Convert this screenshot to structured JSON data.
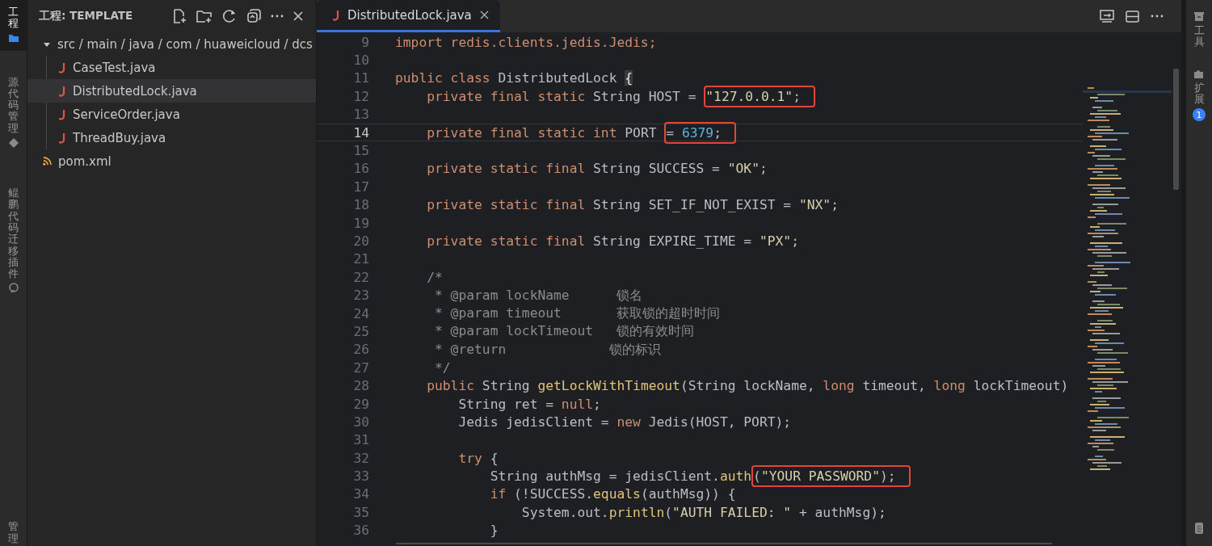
{
  "activity_bar": {
    "items": [
      {
        "label": "工程",
        "selected": true
      },
      {
        "label": "源代码管理",
        "selected": false
      },
      {
        "label": "鲲鹏代码迁移插件",
        "selected": false
      }
    ],
    "bottom_label": "管理"
  },
  "sidebar": {
    "title": "工程: TEMPLATE",
    "tree": [
      {
        "label": "src / main / java / com / huaweicloud / dcs",
        "kind": "folder",
        "expanded": true,
        "selected": false,
        "children": [
          {
            "label": "CaseTest.java",
            "kind": "java",
            "selected": false
          },
          {
            "label": "DistributedLock.java",
            "kind": "java",
            "selected": true
          },
          {
            "label": "ServiceOrder.java",
            "kind": "java",
            "selected": false
          },
          {
            "label": "ThreadBuy.java",
            "kind": "java",
            "selected": false
          }
        ]
      },
      {
        "label": "pom.xml",
        "kind": "xml",
        "selected": false
      }
    ]
  },
  "editor": {
    "tabs": [
      {
        "label": "DistributedLock.java",
        "kind": "java",
        "selected": true
      }
    ],
    "lines": [
      {
        "number": "9",
        "current": false,
        "tokens": [
          {
            "kind": "keyword",
            "text": "import redis.clients.jedis.Jedis;"
          }
        ]
      },
      {
        "number": "10",
        "current": false
      },
      {
        "number": "11",
        "current": false,
        "tokens": [
          {
            "kind": "keyword",
            "text": "public class"
          },
          {
            "kind": "plain",
            "text": " DistributedLock "
          },
          {
            "kind": "brace",
            "text": "{"
          }
        ]
      },
      {
        "number": "12",
        "current": false,
        "tokens": [
          {
            "kind": "keyword",
            "text": "    private final static"
          },
          {
            "kind": "plain",
            "text": " String HOST = "
          },
          {
            "kind": "string",
            "text": "\"127.0.0.1\"",
            "boxed": true
          },
          {
            "kind": "plain",
            "text": ";",
            "boxed": true
          }
        ]
      },
      {
        "number": "13",
        "current": false
      },
      {
        "number": "14",
        "current": true,
        "tokens": [
          {
            "kind": "keyword",
            "text": "    private final static int"
          },
          {
            "kind": "plain",
            "text": " PORT "
          },
          {
            "kind": "plain",
            "text": "= ",
            "boxed": true
          },
          {
            "kind": "number",
            "text": "6379",
            "boxed": true
          },
          {
            "kind": "plain",
            "text": ";",
            "boxed": true
          }
        ]
      },
      {
        "number": "15",
        "current": false
      },
      {
        "number": "16",
        "current": false,
        "tokens": [
          {
            "kind": "keyword",
            "text": "    private static final"
          },
          {
            "kind": "plain",
            "text": " String SUCCESS = "
          },
          {
            "kind": "string",
            "text": "\"OK\""
          },
          {
            "kind": "plain",
            "text": ";"
          }
        ]
      },
      {
        "number": "17",
        "current": false
      },
      {
        "number": "18",
        "current": false,
        "tokens": [
          {
            "kind": "keyword",
            "text": "    private static final"
          },
          {
            "kind": "plain",
            "text": " String SET_IF_NOT_EXIST = "
          },
          {
            "kind": "string",
            "text": "\"NX\""
          },
          {
            "kind": "plain",
            "text": ";"
          }
        ]
      },
      {
        "number": "19",
        "current": false
      },
      {
        "number": "20",
        "current": false,
        "tokens": [
          {
            "kind": "keyword",
            "text": "    private static final"
          },
          {
            "kind": "plain",
            "text": " String EXPIRE_TIME = "
          },
          {
            "kind": "string",
            "text": "\"PX\""
          },
          {
            "kind": "plain",
            "text": ";"
          }
        ]
      },
      {
        "number": "21",
        "current": false
      },
      {
        "number": "22",
        "current": false,
        "tokens": [
          {
            "kind": "comment",
            "text": "    /*"
          }
        ]
      },
      {
        "number": "23",
        "current": false,
        "tokens": [
          {
            "kind": "comment",
            "text": "     * @param lockName      锁名"
          }
        ]
      },
      {
        "number": "24",
        "current": false,
        "tokens": [
          {
            "kind": "comment",
            "text": "     * @param timeout       获取锁的超时时间"
          }
        ]
      },
      {
        "number": "25",
        "current": false,
        "tokens": [
          {
            "kind": "comment",
            "text": "     * @param lockTimeout   锁的有效时间"
          }
        ]
      },
      {
        "number": "26",
        "current": false,
        "tokens": [
          {
            "kind": "comment",
            "text": "     * @return             锁的标识"
          }
        ]
      },
      {
        "number": "27",
        "current": false,
        "tokens": [
          {
            "kind": "comment",
            "text": "     */"
          }
        ]
      },
      {
        "number": "28",
        "current": false,
        "tokens": [
          {
            "kind": "keyword",
            "text": "    public"
          },
          {
            "kind": "plain",
            "text": " String "
          },
          {
            "kind": "function",
            "text": "getLockWithTimeout"
          },
          {
            "kind": "plain",
            "text": "(String lockName, "
          },
          {
            "kind": "keyword",
            "text": "long"
          },
          {
            "kind": "plain",
            "text": " timeout, "
          },
          {
            "kind": "keyword",
            "text": "long"
          },
          {
            "kind": "plain",
            "text": " lockTimeout)"
          }
        ]
      },
      {
        "number": "29",
        "current": false,
        "tokens": [
          {
            "kind": "plain",
            "text": "        String ret = "
          },
          {
            "kind": "keyword",
            "text": "null"
          },
          {
            "kind": "plain",
            "text": ";"
          }
        ]
      },
      {
        "number": "30",
        "current": false,
        "tokens": [
          {
            "kind": "plain",
            "text": "        Jedis jedisClient = "
          },
          {
            "kind": "keyword",
            "text": "new"
          },
          {
            "kind": "plain",
            "text": " Jedis(HOST, PORT);"
          }
        ]
      },
      {
        "number": "31",
        "current": false
      },
      {
        "number": "32",
        "current": false,
        "tokens": [
          {
            "kind": "keyword",
            "text": "        try"
          },
          {
            "kind": "plain",
            "text": " {"
          }
        ]
      },
      {
        "number": "33",
        "current": false,
        "tokens": [
          {
            "kind": "plain",
            "text": "            String authMsg = jedisClient."
          },
          {
            "kind": "function",
            "text": "auth"
          },
          {
            "kind": "plain",
            "text": "(",
            "boxed": true
          },
          {
            "kind": "string",
            "text": "\"YOUR PASSWORD\"",
            "boxed": true
          },
          {
            "kind": "plain",
            "text": ");",
            "boxed": true
          }
        ]
      },
      {
        "number": "34",
        "current": false,
        "tokens": [
          {
            "kind": "keyword",
            "text": "            if"
          },
          {
            "kind": "plain",
            "text": " (!SUCCESS."
          },
          {
            "kind": "function",
            "text": "equals"
          },
          {
            "kind": "plain",
            "text": "(authMsg)) {"
          }
        ]
      },
      {
        "number": "35",
        "current": false,
        "tokens": [
          {
            "kind": "plain",
            "text": "                System.out."
          },
          {
            "kind": "function",
            "text": "println"
          },
          {
            "kind": "plain",
            "text": "("
          },
          {
            "kind": "string",
            "text": "\"AUTH FAILED: \""
          },
          {
            "kind": "plain",
            "text": " + authMsg);"
          }
        ]
      },
      {
        "number": "36",
        "current": false,
        "tokens": [
          {
            "kind": "plain",
            "text": "            }"
          }
        ]
      }
    ]
  },
  "right_bar": {
    "items": [
      {
        "label": "工具"
      },
      {
        "label": "扩展",
        "badge": "1"
      }
    ]
  }
}
